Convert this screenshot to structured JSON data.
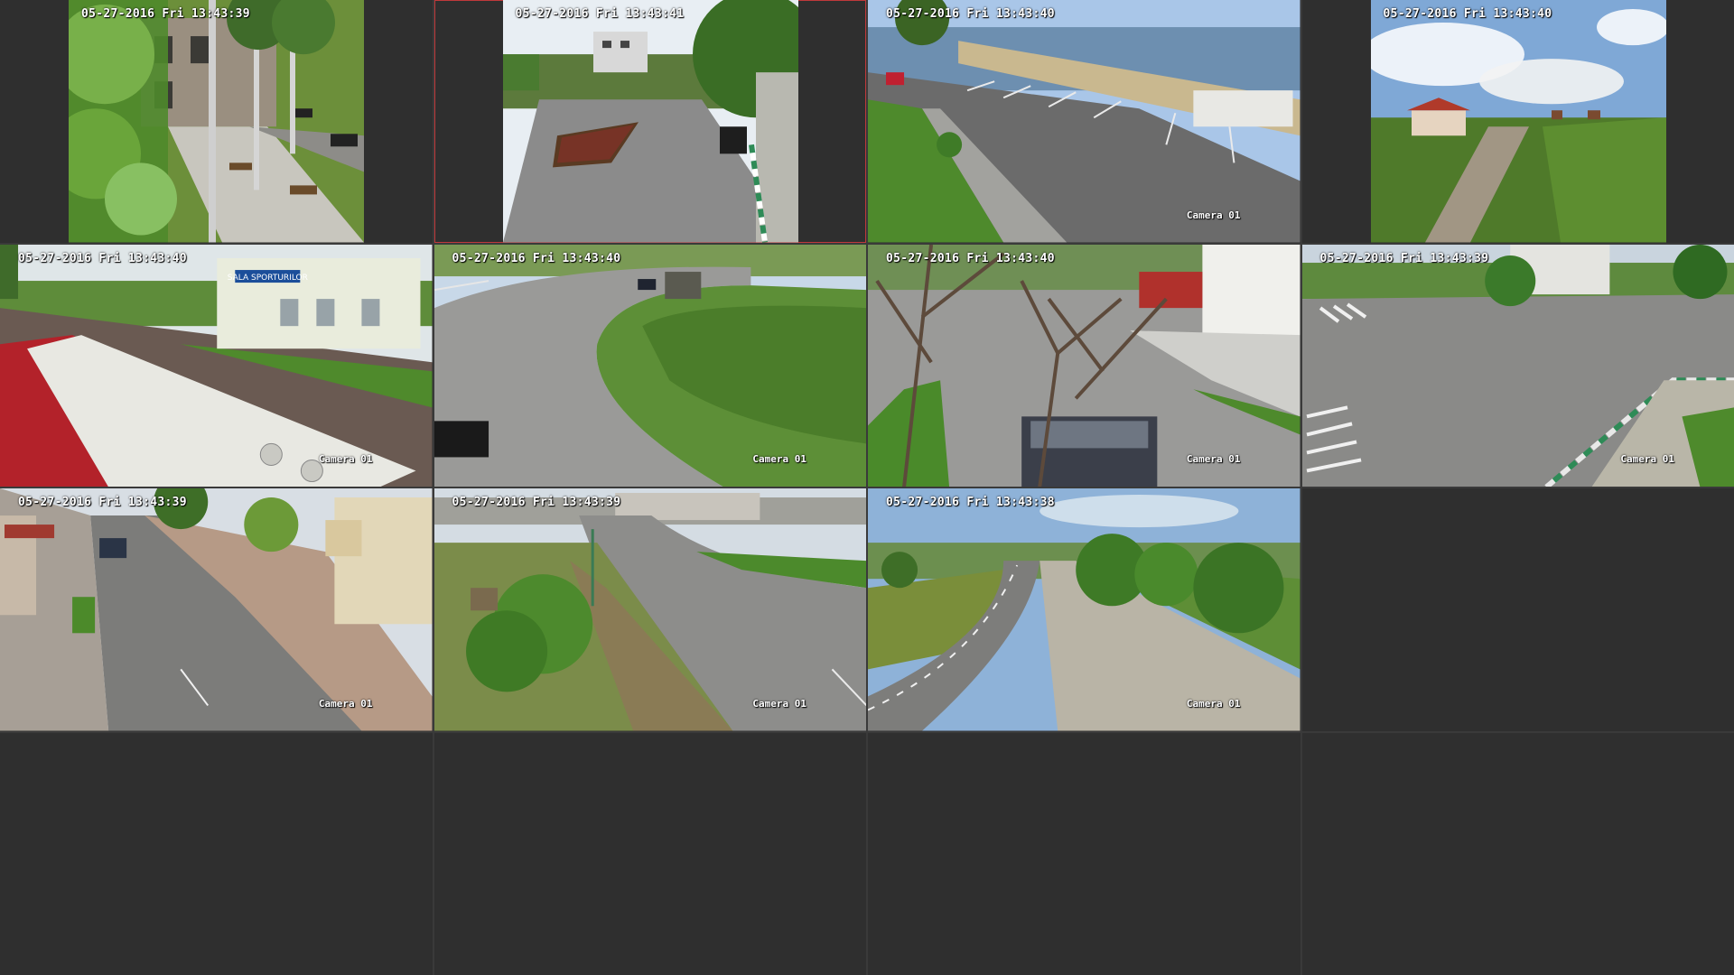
{
  "layout": {
    "columns": 4,
    "rows": 4,
    "selected_channel": 2
  },
  "colors": {
    "background": "#2b2b2b",
    "divider": "#3a3a3a",
    "selected_border": "#c0393b",
    "osd_text": "#ffffff"
  },
  "channels": [
    {
      "id": 1,
      "timestamp": "05-27-2016 Fri 13:43:39",
      "camera_label": "",
      "scene": "park-building",
      "aspect": "4:3"
    },
    {
      "id": 2,
      "timestamp": "05-27-2016 Fri 13:43:41",
      "camera_label": "",
      "scene": "roundabout-street",
      "aspect": "4:3"
    },
    {
      "id": 3,
      "timestamp": "05-27-2016 Fri 13:43:40",
      "camera_label": "Camera 01",
      "scene": "lakeside-parking",
      "aspect": "16:9"
    },
    {
      "id": 4,
      "timestamp": "05-27-2016 Fri 13:43:40",
      "camera_label": "",
      "scene": "field-villa",
      "aspect": "4:3"
    },
    {
      "id": 5,
      "timestamp": "05-27-2016 Fri 13:43:40",
      "camera_label": "Camera 01",
      "scene": "sports-hall-bus",
      "aspect": "16:9",
      "sign_text": "SALA SPORTURILOR"
    },
    {
      "id": 6,
      "timestamp": "05-27-2016 Fri 13:43:40",
      "camera_label": "Camera 01",
      "scene": "curved-road-grass",
      "aspect": "16:9"
    },
    {
      "id": 7,
      "timestamp": "05-27-2016 Fri 13:43:40",
      "camera_label": "Camera 01",
      "scene": "tree-house-car",
      "aspect": "16:9"
    },
    {
      "id": 8,
      "timestamp": "05-27-2016 Fri 13:43:39",
      "camera_label": "Camera 01",
      "scene": "intersection",
      "aspect": "16:9"
    },
    {
      "id": 9,
      "timestamp": "05-27-2016 Fri 13:43:39",
      "camera_label": "Camera 01",
      "scene": "residential-street",
      "aspect": "16:9"
    },
    {
      "id": 10,
      "timestamp": "05-27-2016 Fri 13:43:39",
      "camera_label": "Camera 01",
      "scene": "junction-bush",
      "aspect": "16:9"
    },
    {
      "id": 11,
      "timestamp": "05-27-2016 Fri 13:43:38",
      "camera_label": "Camera 01",
      "scene": "rural-road-trees",
      "aspect": "16:9"
    },
    {
      "id": 12,
      "timestamp": "",
      "camera_label": "",
      "scene": "empty"
    },
    {
      "id": 13,
      "timestamp": "",
      "camera_label": "",
      "scene": "empty"
    },
    {
      "id": 14,
      "timestamp": "",
      "camera_label": "",
      "scene": "empty"
    },
    {
      "id": 15,
      "timestamp": "",
      "camera_label": "",
      "scene": "empty"
    },
    {
      "id": 16,
      "timestamp": "",
      "camera_label": "",
      "scene": "empty"
    }
  ]
}
